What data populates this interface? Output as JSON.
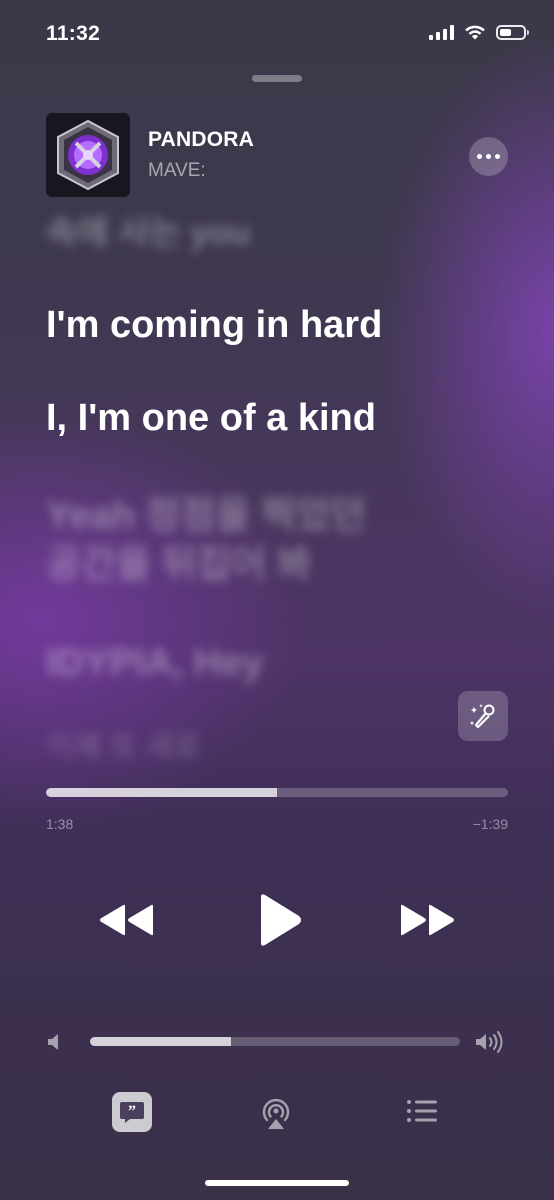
{
  "status_bar": {
    "time": "11:32"
  },
  "now_playing": {
    "title": "PANDORA",
    "artist": "MAVE:",
    "artwork_icon": "album-artwork"
  },
  "lyrics": [
    {
      "text": "속에 사는 you",
      "state": "past"
    },
    {
      "text": "I'm coming in hard",
      "state": "current"
    },
    {
      "text": "I, I'm one of a kind",
      "state": "current"
    },
    {
      "text": "Yeah 정점을 찍었던",
      "state": "upcoming"
    },
    {
      "text": "공간을 뒤집어 봐",
      "state": "upcoming"
    },
    {
      "text": "IDYPIA, Hey",
      "state": "upcoming"
    },
    {
      "text": "이제 또 새로",
      "state": "upcoming"
    }
  ],
  "playback": {
    "elapsed": "1:38",
    "remaining": "−1:39",
    "progress_fraction": 0.5
  },
  "volume": {
    "level_fraction": 0.38
  },
  "icons": {
    "more": "ellipsis-icon",
    "sing": "microphone-sparkle-icon",
    "rewind": "rewind-icon",
    "play": "play-icon",
    "fast_forward": "fast-forward-icon",
    "volume_low": "speaker-low-icon",
    "volume_high": "speaker-high-icon",
    "lyrics": "lyrics-quote-icon",
    "airplay": "airplay-icon",
    "queue": "queue-list-icon"
  },
  "colors": {
    "accent_purple": "#7a3fb0",
    "background": "#3e3850"
  }
}
